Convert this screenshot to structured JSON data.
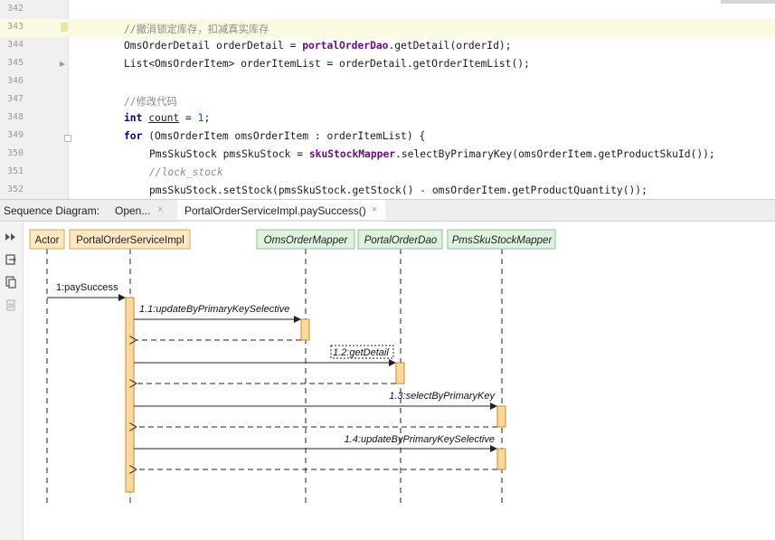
{
  "editor": {
    "lines": [
      {
        "no": "342",
        "text": ""
      },
      {
        "no": "343",
        "text": "//撤消锁定库存，扣减真实库存"
      },
      {
        "no": "344",
        "text": "OmsOrderDetail orderDetail = portalOrderDao.getDetail(orderId);"
      },
      {
        "no": "345",
        "text": "List<OmsOrderItem> orderItemList = orderDetail.getOrderItemList();"
      },
      {
        "no": "346",
        "text": ""
      },
      {
        "no": "347",
        "text": "//修改代码"
      },
      {
        "no": "348",
        "text": "int count = 1;"
      },
      {
        "no": "349",
        "text": "for (OmsOrderItem omsOrderItem : orderItemList) {"
      },
      {
        "no": "350",
        "text": "PmsSkuStock pmsSkuStock = skuStockMapper.selectByPrimaryKey(omsOrderItem.getProductSkuId());"
      },
      {
        "no": "351",
        "text": "//lock_stock"
      },
      {
        "no": "352",
        "text": "pmsSkuStock.setStock(pmsSkuStock.getStock() - omsOrderItem.getProductQuantity());"
      }
    ],
    "tokens": {
      "l343": "//撤消锁定库存，扣减真实库存",
      "l344_a": "OmsOrderDetail orderDetail = ",
      "l344_b": "portalOrderDao",
      "l344_c": ".getDetail(orderId);",
      "l345": "List<OmsOrderItem> orderItemList = orderDetail.getOrderItemList();",
      "l347": "//修改代码",
      "l348_kw": "int",
      "l348_var": "count",
      "l348_eq": " = ",
      "l348_num": "1",
      "l348_end": ";",
      "l349_kw": "for",
      "l349_rest": " (OmsOrderItem omsOrderItem : orderItemList) {",
      "l350_a": "PmsSkuStock pmsSkuStock = ",
      "l350_b": "skuStockMapper",
      "l350_c": ".selectByPrimaryKey(omsOrderItem.getProductSkuId());",
      "l351": "//lock_stock",
      "l352": "pmsSkuStock.setStock(pmsSkuStock.getStock() - omsOrderItem.getProductQuantity());"
    }
  },
  "tabbar": {
    "prefix": "Sequence Diagram:",
    "tabs": [
      {
        "label": "Open...",
        "close": "×"
      },
      {
        "label": "PortalOrderServiceImpl.paySuccess()",
        "close": "×"
      }
    ]
  },
  "toolbar": {
    "icons": [
      "expand-icon",
      "export-icon",
      "copy-icon",
      "settings-icon"
    ]
  },
  "diagram": {
    "participants": [
      {
        "name": "Actor",
        "style": "orange"
      },
      {
        "name": "PortalOrderServiceImpl",
        "style": "orange"
      },
      {
        "name": "OmsOrderMapper",
        "style": "green"
      },
      {
        "name": "PortalOrderDao",
        "style": "green"
      },
      {
        "name": "PmsSkuStockMapper",
        "style": "green"
      }
    ],
    "messages": [
      {
        "label": "1:paySuccess"
      },
      {
        "label": "1.1:updateByPrimaryKeySelective"
      },
      {
        "label": "1.2:getDetail"
      },
      {
        "label": "1.3:selectByPrimaryKey"
      },
      {
        "label": "1.4:updateByPrimaryKeySelective"
      }
    ],
    "colors": {
      "orange_fill": "#fce8c2",
      "orange_border": "#d9a65a",
      "green_fill": "#dff2e0",
      "green_border": "#8fbf93",
      "activation_fill": "#ffd89a",
      "activation_border": "#c48a2e",
      "line": "#222222"
    }
  }
}
